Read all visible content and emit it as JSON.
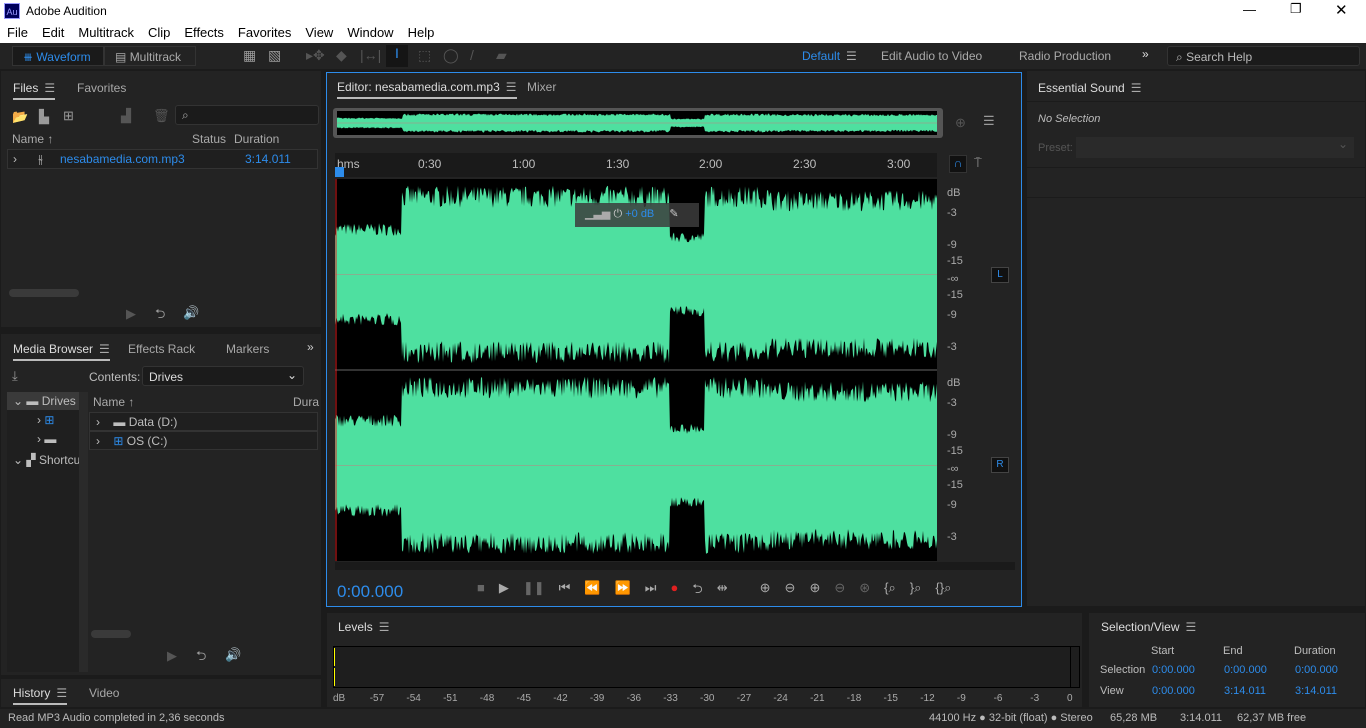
{
  "window": {
    "title": "Adobe Audition",
    "app_icon": "Au"
  },
  "menu": [
    "File",
    "Edit",
    "Multitrack",
    "Clip",
    "Effects",
    "Favorites",
    "View",
    "Window",
    "Help"
  ],
  "toolbar": {
    "waveform": "Waveform",
    "multitrack": "Multitrack",
    "workspaces": [
      "Default",
      "Edit Audio to Video",
      "Radio Production"
    ],
    "search_placeholder": "Search Help"
  },
  "files": {
    "tabs": [
      "Files",
      "Favorites"
    ],
    "columns": [
      "Name",
      "Status",
      "Duration"
    ],
    "items": [
      {
        "name": "nesabamedia.com.mp3",
        "duration": "3:14.011"
      }
    ]
  },
  "media_browser": {
    "tabs": [
      "Media Browser",
      "Effects Rack",
      "Markers"
    ],
    "contents_label": "Contents:",
    "contents_value": "Drives",
    "tree": [
      "Drives",
      "Shortcuts"
    ],
    "columns": [
      "Name",
      "Dura"
    ],
    "items": [
      "Data (D:)",
      "OS (C:)"
    ]
  },
  "history": {
    "tabs": [
      "History",
      "Video"
    ]
  },
  "editor": {
    "tabs": [
      "Editor: nesabamedia.com.mp3",
      "Mixer"
    ],
    "time_ruler": [
      "hms",
      "0:30",
      "1:00",
      "1:30",
      "2:00",
      "2:30",
      "3:00"
    ],
    "hud_gain": "+0 dB",
    "db_scale_l": [
      "dB",
      "-3",
      "-9",
      "-15",
      "-∞",
      "-15",
      "-9",
      "-3"
    ],
    "db_scale_r": [
      "dB",
      "-3",
      "-9",
      "-15",
      "-∞",
      "-15",
      "-9",
      "-3"
    ],
    "channel_l": "L",
    "channel_r": "R",
    "current_time": "0:00.000",
    "waveform_color": "#4ee0a0"
  },
  "essential_sound": {
    "title": "Essential Sound",
    "no_selection": "No Selection",
    "preset_label": "Preset:"
  },
  "levels": {
    "title": "Levels",
    "scale": [
      "dB",
      "-57",
      "-54",
      "-51",
      "-48",
      "-45",
      "-42",
      "-39",
      "-36",
      "-33",
      "-30",
      "-27",
      "-24",
      "-21",
      "-18",
      "-15",
      "-12",
      "-9",
      "-6",
      "-3",
      "0"
    ]
  },
  "selection_view": {
    "title": "Selection/View",
    "headers": [
      "Start",
      "End",
      "Duration"
    ],
    "rows": [
      {
        "label": "Selection",
        "start": "0:00.000",
        "end": "0:00.000",
        "duration": "0:00.000"
      },
      {
        "label": "View",
        "start": "0:00.000",
        "end": "3:14.011",
        "duration": "3:14.011"
      }
    ]
  },
  "status": {
    "message": "Read MP3 Audio completed in 2,36 seconds",
    "format": "44100 Hz ● 32-bit (float) ● Stereo",
    "size": "65,28 MB",
    "duration": "3:14.011",
    "free": "62,37 MB free"
  }
}
